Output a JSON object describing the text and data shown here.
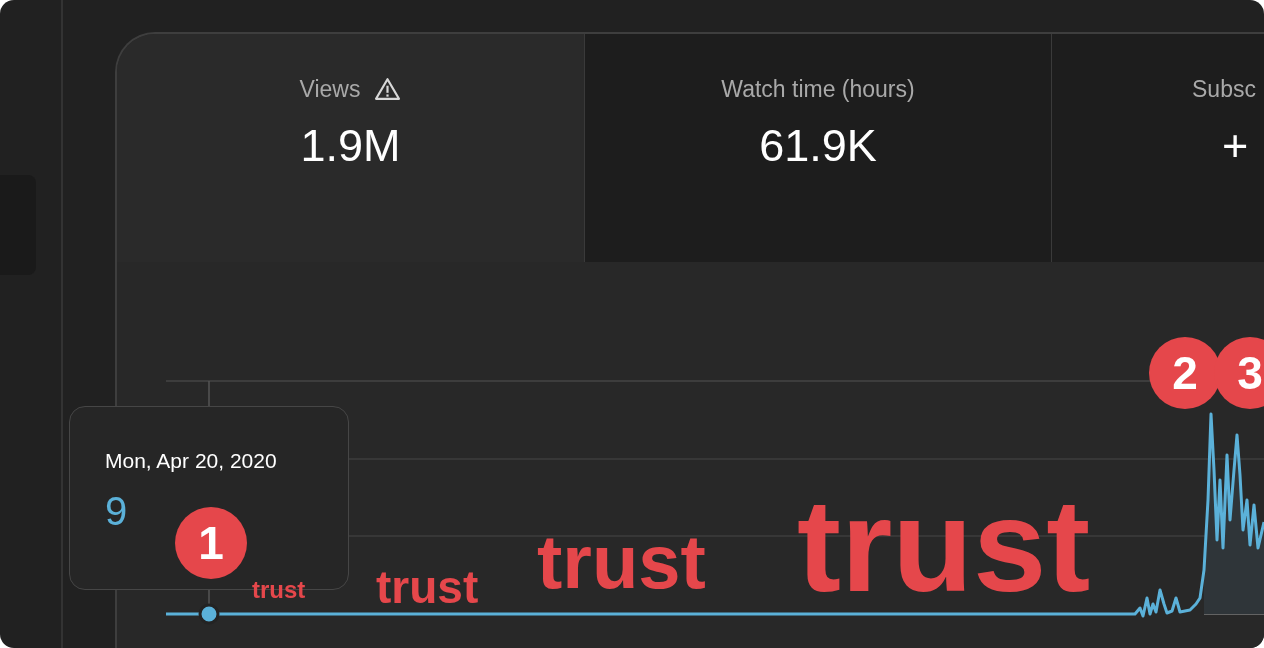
{
  "metrics": [
    {
      "label": "Views",
      "value": "1.9M",
      "warning": true,
      "selected": true
    },
    {
      "label": "Watch time (hours)",
      "value": "61.9K",
      "warning": false,
      "selected": false
    },
    {
      "label": "Subsc",
      "value": "+",
      "warning": false,
      "selected": false
    }
  ],
  "tooltip": {
    "date": "Mon, Apr 20, 2020",
    "value": "9"
  },
  "annotation_badges": [
    "1",
    "2",
    "3"
  ],
  "annotation_words": [
    "trust",
    "trust",
    "trust",
    "trust"
  ]
}
